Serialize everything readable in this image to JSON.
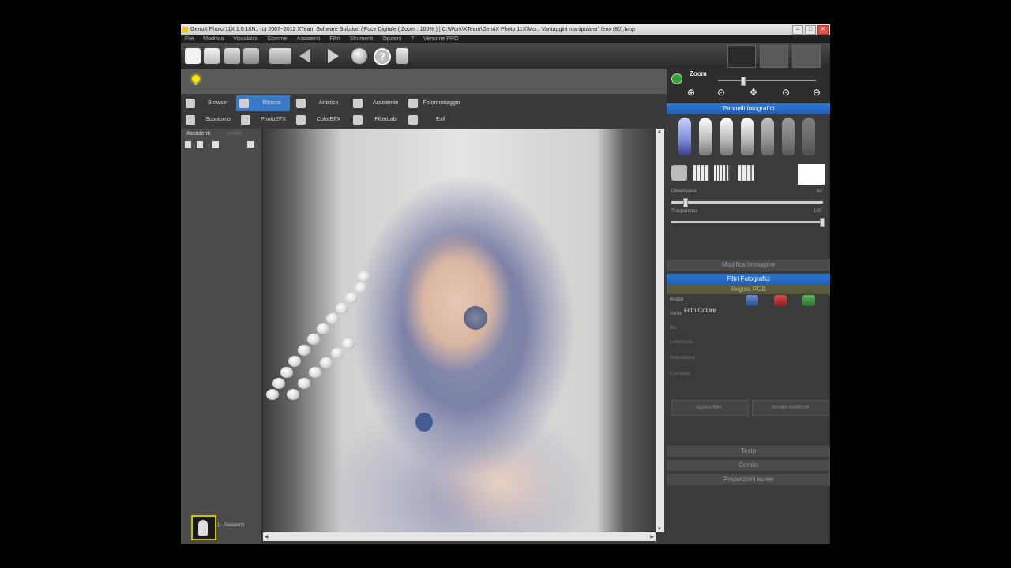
{
  "window": {
    "title": "GenuX Photo 11X  1.0.18N1 (c) 2007~2012 XTeam Software Solution / Fuce Digitale ( Zoom : 100% ) | C:\\Work\\XTeam\\GenuX Photo 11X\\Mo... Vantaggini manipolarer\\ lenx (80).bmp",
    "buttons": [
      "–",
      "□",
      "✕"
    ]
  },
  "menu": [
    "File",
    "Modifica",
    "Visualizza",
    "Gomme",
    "Assistenti",
    "Filtri",
    "Strumenti",
    "Opzioni",
    "?",
    "Versione PRO"
  ],
  "toolbar": {
    "buttons": [
      "new-icon",
      "open-icon",
      "save-icon",
      "print-icon",
      "tools-icon",
      "back-icon",
      "forward-icon",
      "sphere-icon",
      "help-icon",
      "document-icon"
    ],
    "right_buttons": [
      "settings-icon",
      "gears-icon",
      "dial-icon"
    ]
  },
  "module_tabs": [
    {
      "label": "Browser",
      "icon": "folder-icon",
      "selected": false
    },
    {
      "label": "Ritocco",
      "icon": "sun-icon",
      "selected": true
    },
    {
      "label": "Artistico",
      "icon": "brush-icon",
      "selected": false
    },
    {
      "label": "Assistente",
      "icon": "wizard-icon",
      "selected": false
    },
    {
      "label": "Fotomontaggio",
      "icon": "person-icon",
      "selected": false
    },
    {
      "label": "Scontorno",
      "icon": "pen-icon",
      "selected": false
    },
    {
      "label": "PhotoEFX",
      "icon": "camera-icon",
      "selected": false
    },
    {
      "label": "ColorEFX",
      "icon": "palette-icon",
      "selected": false
    },
    {
      "label": "FilterLab",
      "icon": "flask-icon",
      "selected": false
    },
    {
      "label": "Exif",
      "icon": "doc-icon",
      "selected": false
    }
  ],
  "assistant_panel": {
    "tabs": [
      "Assistenti",
      "Livello"
    ],
    "thumb_label": "1 - Assistenti"
  },
  "right_panel": {
    "zoom_label": "Zoom",
    "pennelli_header": "Pennelli fotografici",
    "dimensione_label": "Dimensione",
    "dimensione_value": "50",
    "trasparenza_label": "Trasparenza",
    "trasparenza_value": "100",
    "dimensione_level": 0.08,
    "trasparenza_level": 1.0,
    "modifica_header": "Modifica Immagine",
    "filtri_header": "Filtri Fotografici",
    "rgb_label": "Regola RGB",
    "filtri_colore_label": "Filtri Colore",
    "rows": [
      "Rosso",
      "Verde",
      "Blu",
      "Luminosità",
      "Saturazione",
      "Contrasto"
    ],
    "button_left": "Applica filtro",
    "button_right": "Annulla modifiche",
    "lower_sections": [
      "Testo",
      "Cornici",
      "Proporzioni auree"
    ]
  },
  "colors": {
    "accent_blue": "#2d77d1",
    "selected_tab": "#3a78c8",
    "bulb": "#ffe600",
    "zoom_icon": "#2fa830"
  }
}
